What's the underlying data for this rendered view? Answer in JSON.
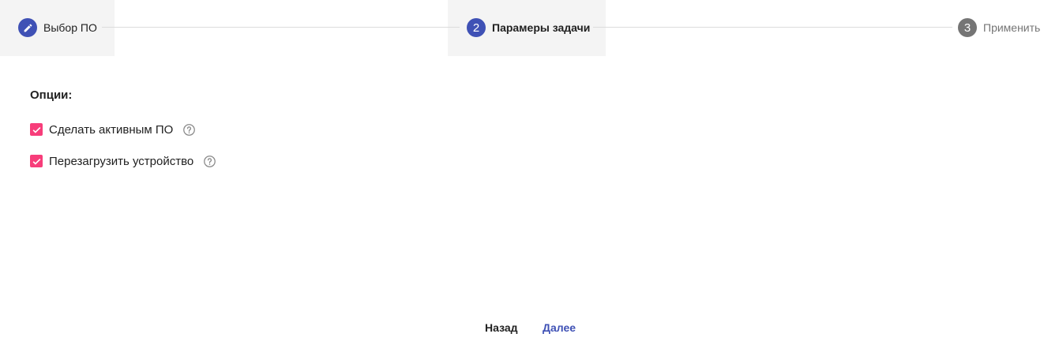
{
  "stepper": {
    "steps": [
      {
        "number": "",
        "label": "Выбор ПО",
        "state": "done",
        "icon": "pencil-icon"
      },
      {
        "number": "2",
        "label": "Парамеры задачи",
        "state": "current"
      },
      {
        "number": "3",
        "label": "Применить",
        "state": "pending"
      }
    ]
  },
  "options": {
    "title": "Опции:",
    "items": [
      {
        "label": "Сделать активным ПО",
        "checked": true,
        "help_icon": "help-circle-icon"
      },
      {
        "label": "Перезагрузить устройство",
        "checked": true,
        "help_icon": "help-circle-icon"
      }
    ]
  },
  "footer": {
    "back_label": "Назад",
    "next_label": "Далее"
  },
  "colors": {
    "primary": "#3f51b5",
    "checkbox": "#f73d7a",
    "inactive_step": "#757575",
    "step_bg": "#f4f4f4"
  }
}
